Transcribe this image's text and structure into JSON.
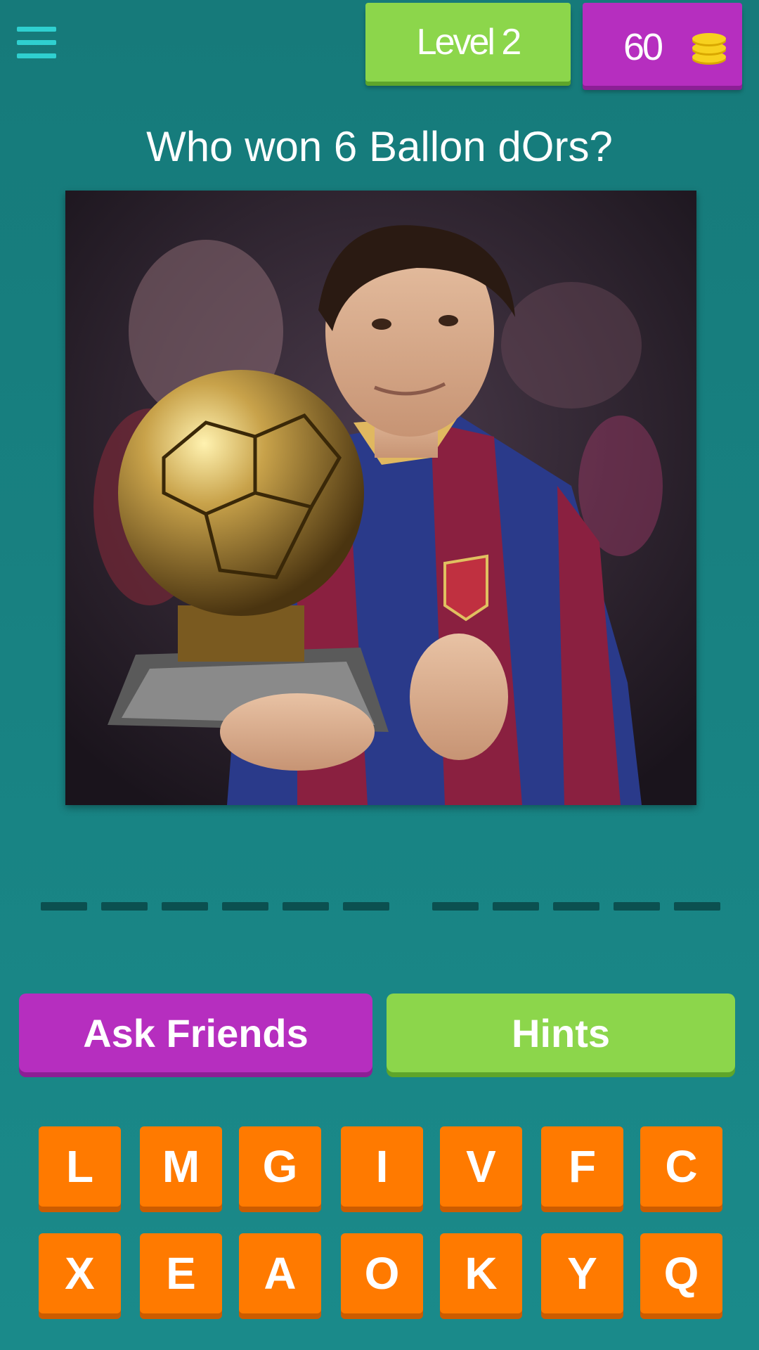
{
  "header": {
    "menu_icon": "hamburger-menu-icon",
    "level_label": "Level 2",
    "coins": "60",
    "coins_icon": "coin-stack-icon"
  },
  "question": "Who won 6 Ballon dOrs?",
  "answer": {
    "word_lengths": [
      6,
      5
    ]
  },
  "actions": {
    "ask_friends": "Ask Friends",
    "hints": "Hints"
  },
  "keyboard": {
    "row1": [
      "L",
      "M",
      "G",
      "I",
      "V",
      "F",
      "C"
    ],
    "row2": [
      "X",
      "E",
      "A",
      "O",
      "K",
      "Y",
      "Q"
    ]
  },
  "colors": {
    "background": "#1a8a8a",
    "level_green": "#8cd64b",
    "coins_purple": "#b62ebf",
    "key_orange": "#ff7a00",
    "coin_yellow": "#f7d11e"
  }
}
